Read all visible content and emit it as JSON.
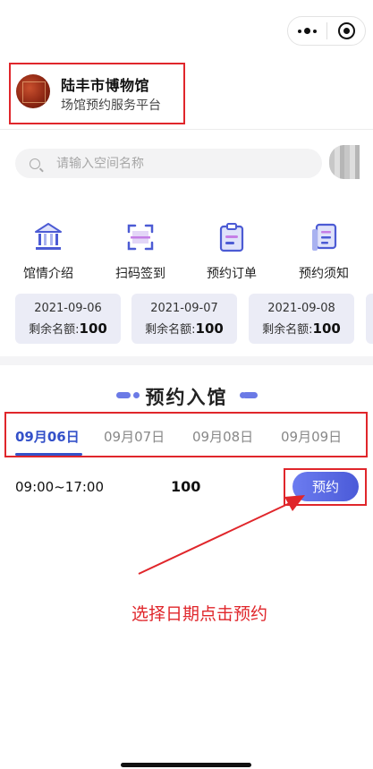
{
  "capsule": {
    "more_icon": "more-dots-icon",
    "close_icon": "target-close-icon"
  },
  "header": {
    "title": "陆丰市博物馆",
    "subtitle": "场馆预约服务平台"
  },
  "search": {
    "placeholder": "请输入空间名称"
  },
  "menu": [
    {
      "label": "馆情介绍",
      "icon": "museum-icon"
    },
    {
      "label": "扫码签到",
      "icon": "scan-icon"
    },
    {
      "label": "预约订单",
      "icon": "clipboard-icon"
    },
    {
      "label": "预约须知",
      "icon": "notice-list-icon"
    }
  ],
  "quota_cards": [
    {
      "date": "2021-09-06",
      "quota_label": "剩余名额:",
      "quota": "100"
    },
    {
      "date": "2021-09-07",
      "quota_label": "剩余名额:",
      "quota": "100"
    },
    {
      "date": "2021-09-08",
      "quota_label": "剩余名额:",
      "quota": "100"
    }
  ],
  "section": {
    "title": "预约入馆"
  },
  "date_tabs": [
    {
      "label": "09月06日",
      "active": true
    },
    {
      "label": "09月07日",
      "active": false
    },
    {
      "label": "09月08日",
      "active": false
    },
    {
      "label": "09月09日",
      "active": false
    }
  ],
  "slot": {
    "time": "09:00~17:00",
    "count": "100",
    "button_label": "预约"
  },
  "annotation": {
    "hint": "选择日期点击预约"
  },
  "colors": {
    "accent": "#3451c9",
    "button": "#5565e4",
    "annotation_red": "#e0262b",
    "card_bg": "#ebecf6"
  }
}
